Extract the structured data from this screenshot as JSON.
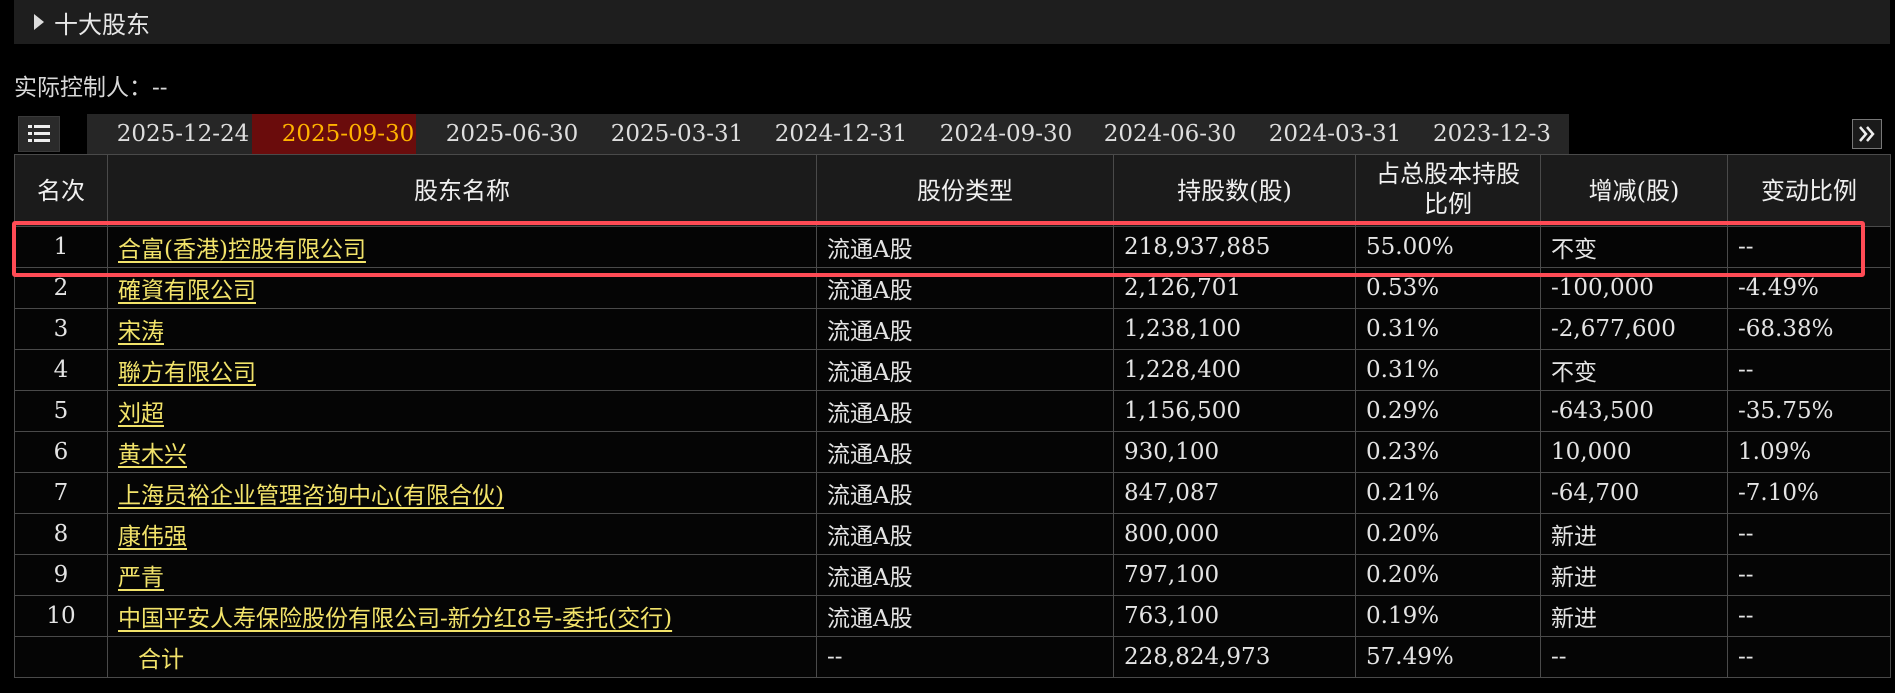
{
  "section": {
    "title": "十大股东"
  },
  "controller": {
    "label": "实际控制人：--"
  },
  "tabs": [
    {
      "label": "2025-12-24",
      "active": false
    },
    {
      "label": "2025-09-30",
      "active": true
    },
    {
      "label": "2025-06-30",
      "active": false
    },
    {
      "label": "2025-03-31",
      "active": false
    },
    {
      "label": "2024-12-31",
      "active": false
    },
    {
      "label": "2024-09-30",
      "active": false
    },
    {
      "label": "2024-06-30",
      "active": false
    },
    {
      "label": "2024-03-31",
      "active": false
    },
    {
      "label": "2023-12-3",
      "active": false
    }
  ],
  "icons": {
    "menu": "list-icon",
    "next": "double-chevron-right-icon"
  },
  "colors": {
    "active_tab_bg": "#6a0c0c",
    "active_tab_text": "#ffb300",
    "name": "#f2e36a",
    "increase": "#ff2f2f",
    "decrease": "#2ed34e",
    "highlight": "#ff4b55"
  },
  "table": {
    "headers": {
      "rank": "名次",
      "name": "股东名称",
      "type": "股份类型",
      "shares": "持股数(股)",
      "ratio_line1": "占总股本持股",
      "ratio_line2": "比例",
      "change": "增减(股)",
      "change_ratio": "变动比例"
    },
    "rows": [
      {
        "rank": "1",
        "name": "合富(香港)控股有限公司",
        "type": "流通A股",
        "shares": "218,937,885",
        "ratio": "55.00%",
        "change": "不变",
        "change_ratio": "--"
      },
      {
        "rank": "2",
        "name": "確資有限公司",
        "type": "流通A股",
        "shares": "2,126,701",
        "ratio": "0.53%",
        "change": "-100,000",
        "change_ratio": "-4.49%"
      },
      {
        "rank": "3",
        "name": "宋涛",
        "type": "流通A股",
        "shares": "1,238,100",
        "ratio": "0.31%",
        "change": "-2,677,600",
        "change_ratio": "-68.38%"
      },
      {
        "rank": "4",
        "name": "聯方有限公司",
        "type": "流通A股",
        "shares": "1,228,400",
        "ratio": "0.31%",
        "change": "不变",
        "change_ratio": "--"
      },
      {
        "rank": "5",
        "name": "刘超",
        "type": "流通A股",
        "shares": "1,156,500",
        "ratio": "0.29%",
        "change": "-643,500",
        "change_ratio": "-35.75%"
      },
      {
        "rank": "6",
        "name": "黄木兴",
        "type": "流通A股",
        "shares": "930,100",
        "ratio": "0.23%",
        "change": "10,000",
        "change_ratio": "1.09%"
      },
      {
        "rank": "7",
        "name": "上海员裕企业管理咨询中心(有限合伙)",
        "type": "流通A股",
        "shares": "847,087",
        "ratio": "0.21%",
        "change": "-64,700",
        "change_ratio": "-7.10%"
      },
      {
        "rank": "8",
        "name": "康伟强",
        "type": "流通A股",
        "shares": "800,000",
        "ratio": "0.20%",
        "change": "新进",
        "change_ratio": "--"
      },
      {
        "rank": "9",
        "name": "严青",
        "type": "流通A股",
        "shares": "797,100",
        "ratio": "0.20%",
        "change": "新进",
        "change_ratio": "--"
      },
      {
        "rank": "10",
        "name": "中国平安人寿保险股份有限公司-新分红8号-委托(交行)",
        "type": "流通A股",
        "shares": "763,100",
        "ratio": "0.19%",
        "change": "新进",
        "change_ratio": "--"
      }
    ],
    "total": {
      "label": "合计",
      "type": "--",
      "shares": "228,824,973",
      "ratio": "57.49%",
      "change": "--",
      "change_ratio": "--"
    }
  }
}
